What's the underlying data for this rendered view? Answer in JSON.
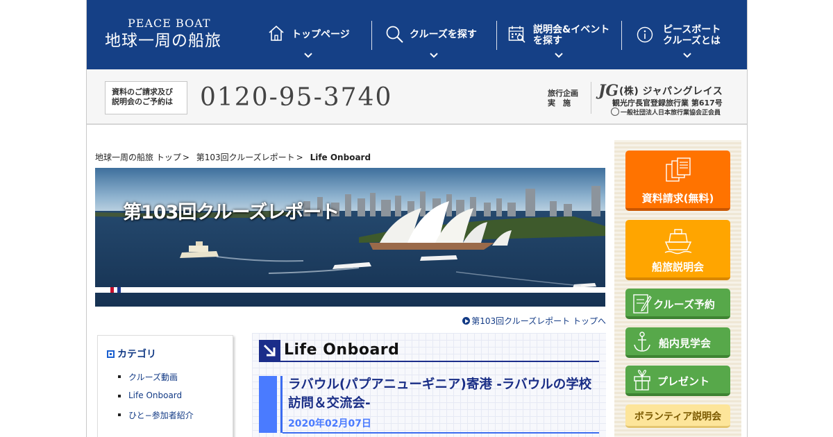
{
  "header": {
    "logo_en": "PEACE BOAT",
    "logo_ja": "地球一周の船旅",
    "nav": [
      {
        "label": "トップページ",
        "icon": "home-icon"
      },
      {
        "label": "クルーズを探す",
        "icon": "search-icon"
      },
      {
        "label_line1": "説明会&イベント",
        "label_line2": "を探す",
        "icon": "calendar-icon"
      },
      {
        "label_line1": "ピースボート",
        "label_line2": "クルーズとは",
        "icon": "info-icon"
      }
    ]
  },
  "contact": {
    "box_line1": "資料のご請求及び",
    "box_line2": "説明会のご予約は",
    "phone": "0120-95-3740",
    "agency_label_line1": "旅行企画",
    "agency_label_line2": "実　施",
    "agency_name": "(株) ジャパングレイス",
    "agency_reg": "観光庁長官登録旅行業 第617号",
    "agency_assoc": "一般社団法人日本旅行業協会正会員"
  },
  "breadcrumb": [
    {
      "label": "地球一周の船旅 トップ"
    },
    {
      "label": "第103回クルーズレポート"
    },
    {
      "label": "Life Onboard"
    }
  ],
  "hero": {
    "title": "第103回クルーズレポート"
  },
  "report_top_link": "第103回クルーズレポート トップへ",
  "category": {
    "heading": "カテゴリ",
    "items": [
      "クルーズ動画",
      "Life Onboard",
      "ひと−参加者紹介"
    ]
  },
  "article": {
    "section_title": "Life Onboard",
    "post_title": "ラバウル(パプアニューギニア)寄港 -ラバウルの学校訪問＆交流会-",
    "post_date": "2020年02月07日"
  },
  "sidebar": {
    "buttons": [
      {
        "label": "資料請求(無料)",
        "icon": "brochure-icon"
      },
      {
        "label": "船旅説明会",
        "icon": "ship-icon"
      },
      {
        "label": "クルーズ予約",
        "icon": "form-icon"
      },
      {
        "label": "船内見学会",
        "icon": "anchor-icon"
      },
      {
        "label": "プレゼント",
        "icon": "gift-icon"
      },
      {
        "label": "ボランティア説明会"
      }
    ]
  },
  "colors": {
    "header_bg": "#154086",
    "orange": "#ff7300",
    "amber": "#ffa500",
    "green": "#57a84a",
    "accent_blue": "#4a7bff"
  }
}
